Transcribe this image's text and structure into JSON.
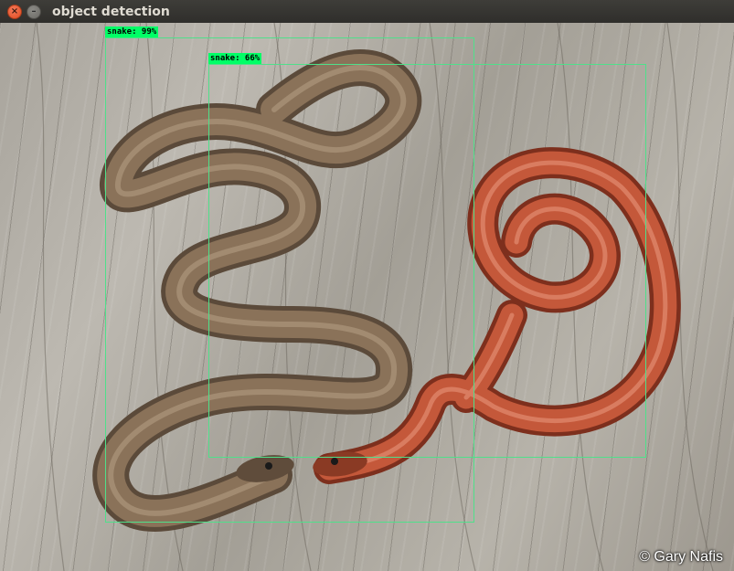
{
  "window": {
    "title": "object detection",
    "close_glyph": "×",
    "minimize_glyph": "–"
  },
  "detections": [
    {
      "label": "snake: 99%",
      "class": "snake",
      "score": 0.99
    },
    {
      "label": "snake: 66%",
      "class": "snake",
      "score": 0.66
    }
  ],
  "image": {
    "credit": "© Gary Nafis",
    "subjects": [
      "brown-snake",
      "red-snake"
    ],
    "background": "weathered-wood"
  },
  "colors": {
    "bbox": "#4fe08a",
    "label_bg": "#00ff66",
    "brown_snake": "#7a624c",
    "red_snake": "#c4583a"
  }
}
